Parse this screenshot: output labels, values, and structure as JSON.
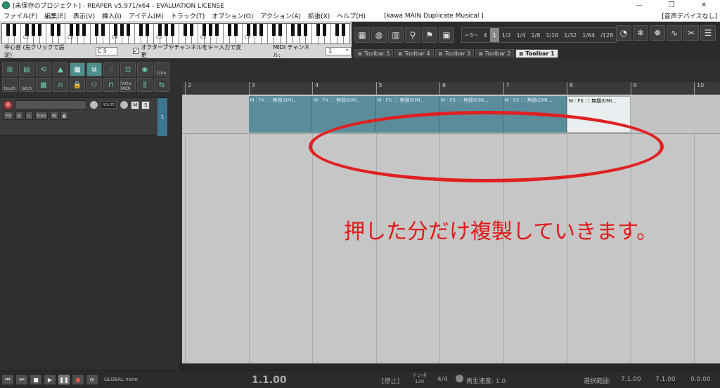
{
  "window": {
    "title": "[未保存のプロジェクト] - REAPER v5.971/x64 - EVALUATION LICENSE",
    "minimize": "—",
    "maximize": "❐",
    "close": "✕"
  },
  "menu": {
    "items": [
      "ファイル(F)",
      "編集(E)",
      "表示(V)",
      "挿入(I)",
      "アイテム(M)",
      "トラック(T)",
      "オプション(O)",
      "アクション(A)",
      "拡張(X)",
      "ヘルプ(H)"
    ],
    "project_label": "[kawa MAIN Duplicate Musical ]",
    "audio_device": "[音声デバイスなし]"
  },
  "keyboard": {
    "octaves": [
      "C2",
      "C3",
      "C4",
      "C5",
      "C6",
      "C7"
    ],
    "center_label": "中心音 (右クリックで設定)",
    "center_value": "C 5",
    "check_label": "オクターブやチャンネルをキー入力で変更",
    "midi_channel_label": "MIDI チャンネル:",
    "midi_channel_value": "1"
  },
  "toolbar": {
    "grid_options": [
      "4",
      "1",
      "1/2",
      "1/4",
      "1/8",
      "1/16",
      "1/32",
      "1/64",
      "/128"
    ],
    "grid_active": "1",
    "tabs": [
      "Toolbar 5",
      "Toolbar 4",
      "Toolbar 3",
      "Toolbar 2",
      "Toolbar 1"
    ],
    "active_tab": "Toolbar 1"
  },
  "left_tools": {
    "labels": [
      "touch",
      "latch",
      "Virtu MIDI",
      "trim"
    ]
  },
  "track": {
    "number": "1",
    "record_arm": "A",
    "route": "ROUTE",
    "mute": "M",
    "solo": "S",
    "fx": "FX",
    "trim": "trim",
    "in": "IN"
  },
  "ruler": {
    "bars": [
      "2",
      "3",
      "4",
      "5",
      "6",
      "7",
      "8",
      "9",
      "10"
    ]
  },
  "items": [
    {
      "label": "M ⫶ FX ⬚ 無題のMI..."
    },
    {
      "label": "M ⫶ FX ⬚ 無題のMI..."
    },
    {
      "label": "M ⫶ FX ⬚ 無題のMI..."
    },
    {
      "label": "M ⫶ FX ⬚ 無題のMI..."
    },
    {
      "label": "M ⫶ FX ⬚ 無題のMI..."
    },
    {
      "label": "M ⫶ FX ⬚ 無題のMI..."
    }
  ],
  "annotation": {
    "text": "押した分だけ複製していきます。",
    "color": "#e21818"
  },
  "transport": {
    "mode": "GLOBAL none",
    "position": "1.1.00",
    "state": "[停止]",
    "tempo_label": "テンポ",
    "tempo_value": "120",
    "time_signature": "4/4",
    "rate": "再生速度: 1.0",
    "selection_label": "選択範囲:",
    "selection_start": "7.1.00",
    "selection_end": "7.1.00",
    "selection_length": "0.0.00"
  },
  "colors": {
    "item_fill": "#5b8c9b",
    "item_selected": "#e9eef0",
    "track_number_bg": "#3c7690",
    "ellipse": "#e02020"
  }
}
